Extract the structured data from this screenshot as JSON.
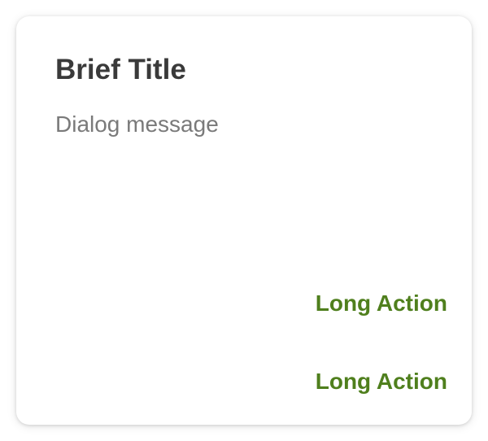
{
  "dialog": {
    "title": "Brief Title",
    "message": "Dialog message",
    "actions": [
      {
        "label": "Long Action"
      },
      {
        "label": "Long Action"
      }
    ]
  },
  "colors": {
    "title": "#3a3a3a",
    "message": "#7a7a7a",
    "action": "#4f7f1d",
    "surface": "#ffffff"
  }
}
